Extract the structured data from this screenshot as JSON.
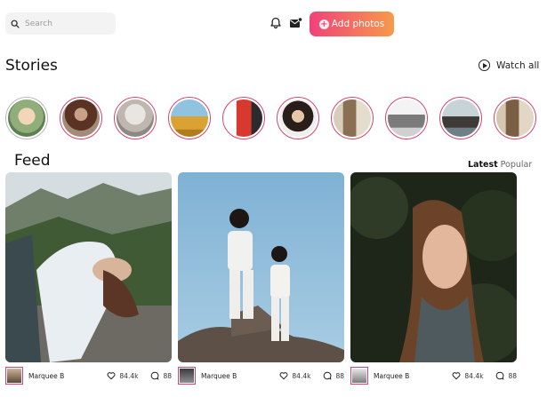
{
  "search": {
    "placeholder": "Search"
  },
  "header": {
    "add_photos_label": "Add photos"
  },
  "stories": {
    "title": "Stories",
    "watch_all_label": "Watch all",
    "items": [
      "story-1",
      "story-2",
      "story-3",
      "story-4",
      "story-5",
      "story-6",
      "story-7",
      "story-8",
      "story-9",
      "story-10"
    ]
  },
  "feed": {
    "title": "Feed",
    "tabs": [
      "Latest",
      "Popular"
    ],
    "active_tab": "Latest",
    "cards": [
      {
        "author": "Marquee B",
        "likes": "84.4k",
        "comments": "88"
      },
      {
        "author": "Marquee B",
        "likes": "84.4k",
        "comments": "88"
      },
      {
        "author": "Marquee B",
        "likes": "84.4k",
        "comments": "88"
      }
    ]
  },
  "colors": {
    "accent_start": "#f0427a",
    "accent_end": "#f79a4a",
    "story_ring": "#d3456e"
  },
  "icons": [
    "search-icon",
    "bell-icon",
    "mail-icon",
    "plus-icon",
    "play-icon",
    "heart-icon",
    "comment-icon"
  ]
}
